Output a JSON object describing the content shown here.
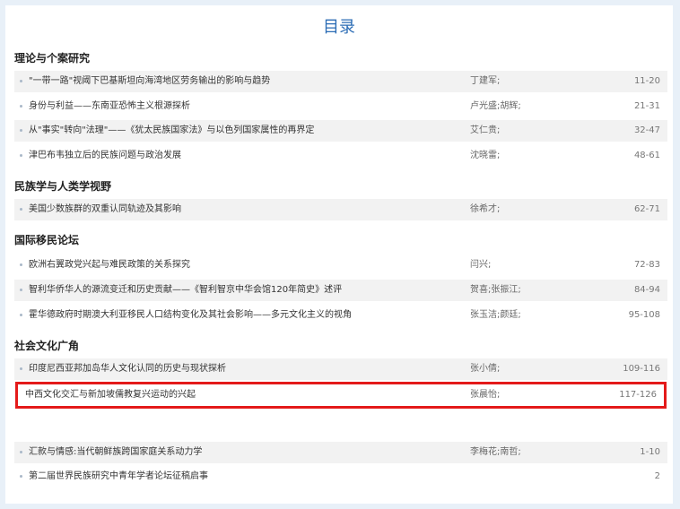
{
  "header": {
    "title": "目录"
  },
  "sections": [
    {
      "title": "理论与个案研究"
    },
    {
      "title": "民族学与人类学视野"
    },
    {
      "title": "国际移民论坛"
    },
    {
      "title": "社会文化广角"
    }
  ],
  "articles": [
    {
      "title": "\"一带一路\"视阈下巴基斯坦向海湾地区劳务输出的影响与趋势",
      "authors": "丁建军;",
      "pages": "11-20"
    },
    {
      "title": "身份与利益——东南亚恐怖主义根源探析",
      "authors": "卢光盛;胡辉;",
      "pages": "21-31"
    },
    {
      "title": "从\"事实\"转向\"法理\"——《犹太民族国家法》与以色列国家属性的再界定",
      "authors": "艾仁贵;",
      "pages": "32-47"
    },
    {
      "title": "津巴布韦独立后的民族问题与政治发展",
      "authors": "沈晓雷;",
      "pages": "48-61"
    },
    {
      "title": "美国少数族群的双重认同轨迹及其影响",
      "authors": "徐希才;",
      "pages": "62-71"
    },
    {
      "title": "欧洲右翼政党兴起与难民政策的关系探究",
      "authors": "闫兴;",
      "pages": "72-83"
    },
    {
      "title": "智利华侨华人的源流变迁和历史贡献——《智利智京中华会馆120年简史》述评",
      "authors": "贺喜;张振江;",
      "pages": "84-94"
    },
    {
      "title": "霍华德政府时期澳大利亚移民人口结构变化及其社会影响——多元文化主义的视角",
      "authors": "张玉洁;颜廷;",
      "pages": "95-108"
    },
    {
      "title": "印度尼西亚邦加岛华人文化认同的历史与现状探析",
      "authors": "张小倩;",
      "pages": "109-116"
    },
    {
      "title": "中西文化交汇与新加坡儒教复兴运动的兴起",
      "authors": "张晨怡;",
      "pages": "117-126"
    },
    {
      "title": "汇款与情感:当代朝鲜族跨国家庭关系动力学",
      "authors": "李梅花;南哲;",
      "pages": "1-10"
    },
    {
      "title": "第二届世界民族研究中青年学者论坛征稿启事",
      "authors": "",
      "pages": "2"
    }
  ]
}
